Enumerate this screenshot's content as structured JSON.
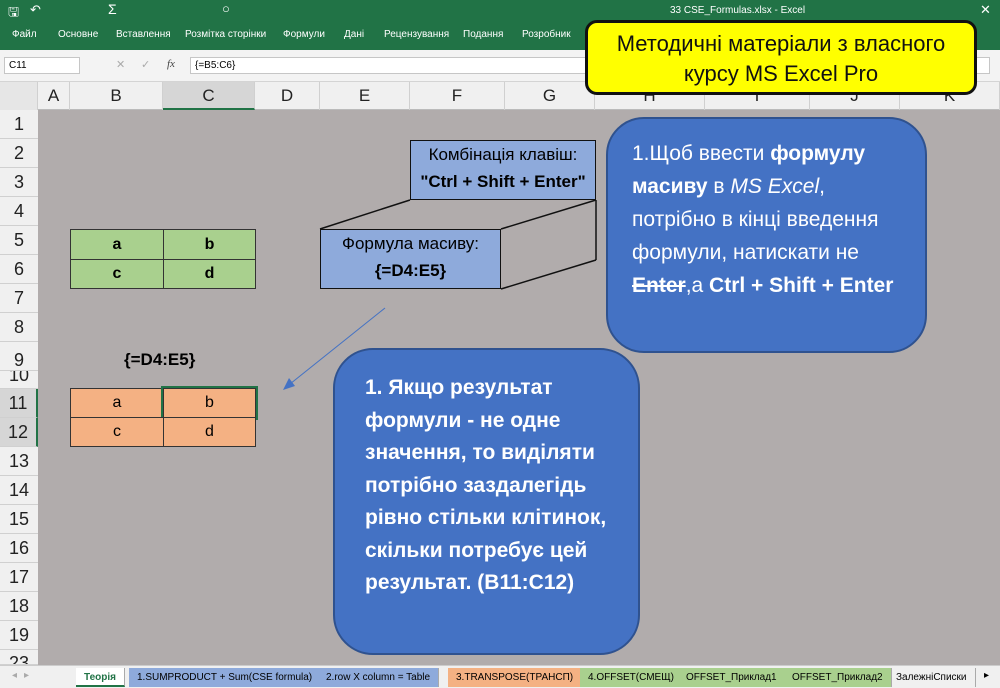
{
  "window": {
    "title": "33 CSE_Formulas.xlsx - Excel"
  },
  "ribbon": {
    "tabs": [
      "Файл",
      "Основне",
      "Вставлення",
      "Розмітка сторінки",
      "Формули",
      "Дані",
      "Рецензування",
      "Подання",
      "Розробник"
    ]
  },
  "formula_bar": {
    "name_box": "C11",
    "formula": "{=B5:C6}",
    "fx": "fx"
  },
  "columns": [
    "A",
    "B",
    "C",
    "D",
    "E",
    "F",
    "G",
    "H",
    "I",
    "J",
    "K"
  ],
  "rows": [
    "1",
    "2",
    "3",
    "4",
    "5",
    "6",
    "7",
    "8",
    "9",
    "10",
    "11",
    "12",
    "13",
    "14",
    "15",
    "16",
    "17",
    "18",
    "19",
    "23"
  ],
  "banner": {
    "line1": "Методичні матеріали з власного",
    "line2": "курсу MS Excel Pro"
  },
  "table1": {
    "cells": [
      "a",
      "b",
      "c",
      "d"
    ],
    "color": "#a9d08e"
  },
  "table2": {
    "label": "{=D4:E5}",
    "cells": [
      "a",
      "b",
      "c",
      "d"
    ],
    "color": "#f4b183"
  },
  "cube": {
    "top_line1": "Комбінація клавіш:",
    "top_line2": "\"Ctrl + Shift + Enter\"",
    "front_line1": "Формула масиву:",
    "front_line2": "{=D4:E5}"
  },
  "callout1": {
    "p1": "1.Щоб ввести ",
    "b1": "формулу масиву",
    "p2": " в ",
    "i1": "MS Excel",
    "p3": ", потрібно в кінці введення формули, натискати не ",
    "s1": "Enter",
    "p4": ",а ",
    "b2": "Ctrl + Shift + Enter"
  },
  "callout2": {
    "text": "1. Якщо результат формули - не одне значення, то виділяти потрібно заздалегідь рівно стільки клітинок, скільки потребує цей результат.  (B11:C12)"
  },
  "sheet_tabs": [
    {
      "label": "Теорія",
      "color": "#ffffff"
    },
    {
      "label": "1.SUMPRODUCT + Sum(CSE formula)",
      "color": "#8eaadb"
    },
    {
      "label": "2.row X column = Table",
      "color": "#8eaadb"
    },
    {
      "label": "3.TRANSPOSE(ТРАНСП)",
      "color": "#f4b183"
    },
    {
      "label": "4.OFFSET(СМЕЩ)",
      "color": "#a9d08e"
    },
    {
      "label": "OFFSET_Приклад1",
      "color": "#a9d08e"
    },
    {
      "label": "OFFSET_Приклад2",
      "color": "#a9d08e"
    },
    {
      "label": "ЗалежніСписки",
      "color": "#f0f0f0"
    }
  ]
}
